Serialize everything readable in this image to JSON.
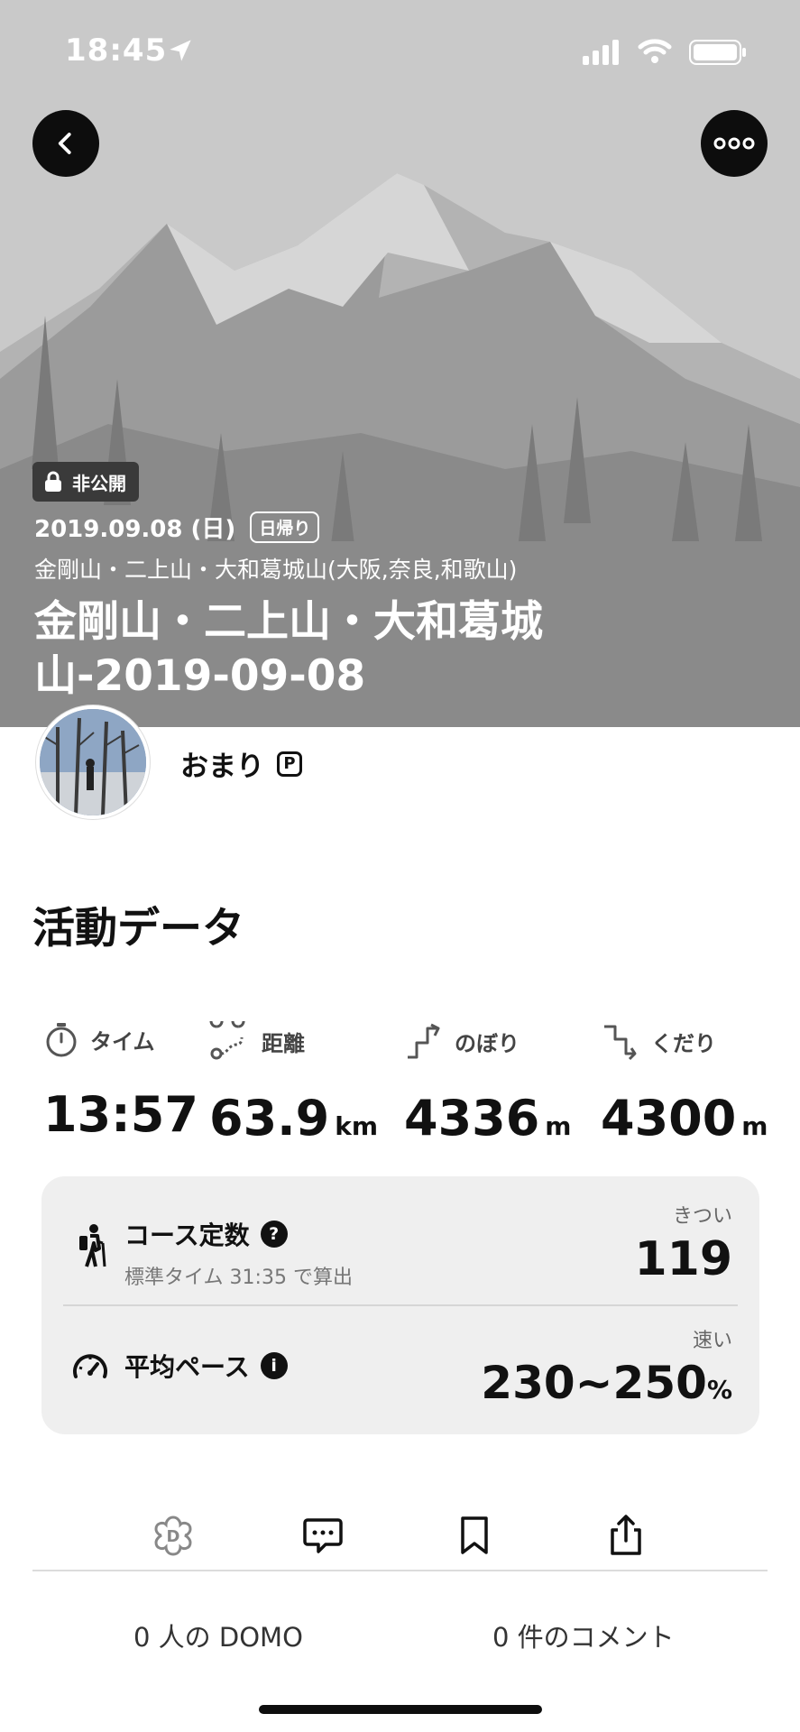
{
  "status_bar": {
    "time": "18:45"
  },
  "header": {
    "visibility_label": "非公開",
    "date": "2019.09.08 (日)",
    "trip_type": "日帰り",
    "region": "金剛山・二上山・大和葛城山(大阪,奈良,和歌山)",
    "title": "金剛山・二上山・大和葛城山-2019-09-08"
  },
  "user": {
    "name": "おまり",
    "badge": "P"
  },
  "activity": {
    "section_title": "活動データ",
    "stats": [
      {
        "label": "タイム",
        "value": "13:57",
        "unit": ""
      },
      {
        "label": "距離",
        "value": "63.9",
        "unit": "km"
      },
      {
        "label": "のぼり",
        "value": "4336",
        "unit": "m"
      },
      {
        "label": "くだり",
        "value": "4300",
        "unit": "m"
      }
    ],
    "course": {
      "title": "コース定数",
      "help": "?",
      "subtitle": "標準タイム 31:35 で算出",
      "level": "きつい",
      "value": "119"
    },
    "pace": {
      "title": "平均ペース",
      "info": "i",
      "level": "速い",
      "value": "230~250",
      "unit": "%"
    }
  },
  "footer": {
    "domo_count": "0 人の DOMO",
    "comment_count": "0 件のコメント"
  },
  "colors": {
    "hero_bg": "#c9c9c9",
    "card_bg": "#efefef",
    "button_bg": "#0d0d0d"
  }
}
